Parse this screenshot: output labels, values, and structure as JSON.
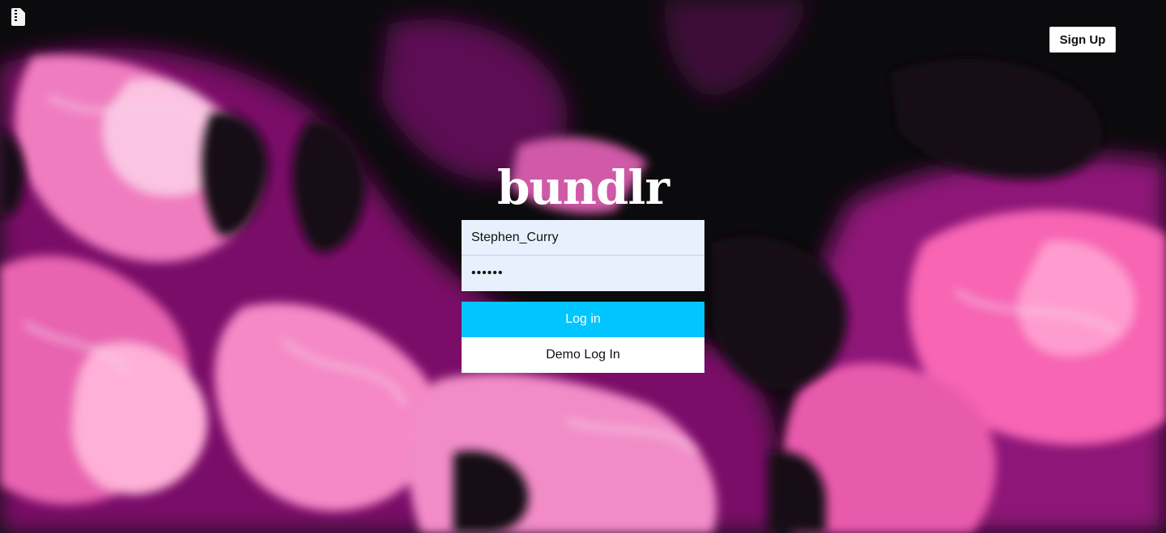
{
  "app": {
    "brand": "bundlr",
    "logo_icon": "zip-file-icon"
  },
  "header": {
    "signup_label": "Sign Up"
  },
  "login_form": {
    "username_value": "Stephen_Curry",
    "password_value": "••••••",
    "login_label": "Log in",
    "demo_label": "Demo Log In"
  },
  "colors": {
    "accent": "#00c5ff",
    "input_bg": "#e8f0fe",
    "background_dark": "#0b0a0c",
    "background_pink": "#f06ab0",
    "background_magenta": "#a0168a"
  }
}
